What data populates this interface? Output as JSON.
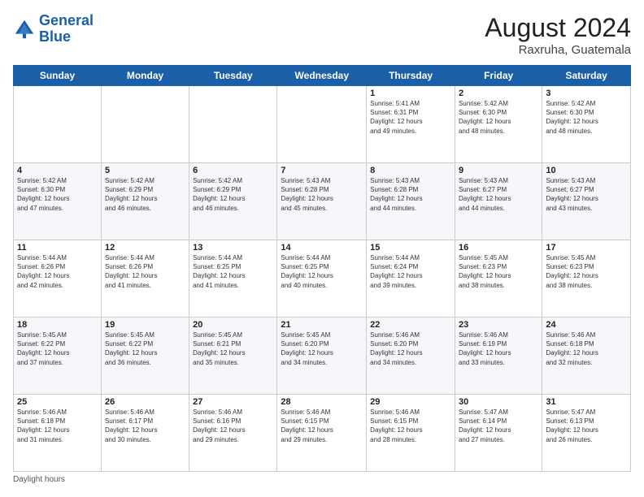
{
  "header": {
    "logo_line1": "General",
    "logo_line2": "Blue",
    "month_year": "August 2024",
    "location": "Raxruha, Guatemala"
  },
  "days_of_week": [
    "Sunday",
    "Monday",
    "Tuesday",
    "Wednesday",
    "Thursday",
    "Friday",
    "Saturday"
  ],
  "weeks": [
    [
      {
        "day": "",
        "info": ""
      },
      {
        "day": "",
        "info": ""
      },
      {
        "day": "",
        "info": ""
      },
      {
        "day": "",
        "info": ""
      },
      {
        "day": "1",
        "info": "Sunrise: 5:41 AM\nSunset: 6:31 PM\nDaylight: 12 hours\nand 49 minutes."
      },
      {
        "day": "2",
        "info": "Sunrise: 5:42 AM\nSunset: 6:30 PM\nDaylight: 12 hours\nand 48 minutes."
      },
      {
        "day": "3",
        "info": "Sunrise: 5:42 AM\nSunset: 6:30 PM\nDaylight: 12 hours\nand 48 minutes."
      }
    ],
    [
      {
        "day": "4",
        "info": "Sunrise: 5:42 AM\nSunset: 6:30 PM\nDaylight: 12 hours\nand 47 minutes."
      },
      {
        "day": "5",
        "info": "Sunrise: 5:42 AM\nSunset: 6:29 PM\nDaylight: 12 hours\nand 46 minutes."
      },
      {
        "day": "6",
        "info": "Sunrise: 5:42 AM\nSunset: 6:29 PM\nDaylight: 12 hours\nand 46 minutes."
      },
      {
        "day": "7",
        "info": "Sunrise: 5:43 AM\nSunset: 6:28 PM\nDaylight: 12 hours\nand 45 minutes."
      },
      {
        "day": "8",
        "info": "Sunrise: 5:43 AM\nSunset: 6:28 PM\nDaylight: 12 hours\nand 44 minutes."
      },
      {
        "day": "9",
        "info": "Sunrise: 5:43 AM\nSunset: 6:27 PM\nDaylight: 12 hours\nand 44 minutes."
      },
      {
        "day": "10",
        "info": "Sunrise: 5:43 AM\nSunset: 6:27 PM\nDaylight: 12 hours\nand 43 minutes."
      }
    ],
    [
      {
        "day": "11",
        "info": "Sunrise: 5:44 AM\nSunset: 6:26 PM\nDaylight: 12 hours\nand 42 minutes."
      },
      {
        "day": "12",
        "info": "Sunrise: 5:44 AM\nSunset: 6:26 PM\nDaylight: 12 hours\nand 41 minutes."
      },
      {
        "day": "13",
        "info": "Sunrise: 5:44 AM\nSunset: 6:25 PM\nDaylight: 12 hours\nand 41 minutes."
      },
      {
        "day": "14",
        "info": "Sunrise: 5:44 AM\nSunset: 6:25 PM\nDaylight: 12 hours\nand 40 minutes."
      },
      {
        "day": "15",
        "info": "Sunrise: 5:44 AM\nSunset: 6:24 PM\nDaylight: 12 hours\nand 39 minutes."
      },
      {
        "day": "16",
        "info": "Sunrise: 5:45 AM\nSunset: 6:23 PM\nDaylight: 12 hours\nand 38 minutes."
      },
      {
        "day": "17",
        "info": "Sunrise: 5:45 AM\nSunset: 6:23 PM\nDaylight: 12 hours\nand 38 minutes."
      }
    ],
    [
      {
        "day": "18",
        "info": "Sunrise: 5:45 AM\nSunset: 6:22 PM\nDaylight: 12 hours\nand 37 minutes."
      },
      {
        "day": "19",
        "info": "Sunrise: 5:45 AM\nSunset: 6:22 PM\nDaylight: 12 hours\nand 36 minutes."
      },
      {
        "day": "20",
        "info": "Sunrise: 5:45 AM\nSunset: 6:21 PM\nDaylight: 12 hours\nand 35 minutes."
      },
      {
        "day": "21",
        "info": "Sunrise: 5:45 AM\nSunset: 6:20 PM\nDaylight: 12 hours\nand 34 minutes."
      },
      {
        "day": "22",
        "info": "Sunrise: 5:46 AM\nSunset: 6:20 PM\nDaylight: 12 hours\nand 34 minutes."
      },
      {
        "day": "23",
        "info": "Sunrise: 5:46 AM\nSunset: 6:19 PM\nDaylight: 12 hours\nand 33 minutes."
      },
      {
        "day": "24",
        "info": "Sunrise: 5:46 AM\nSunset: 6:18 PM\nDaylight: 12 hours\nand 32 minutes."
      }
    ],
    [
      {
        "day": "25",
        "info": "Sunrise: 5:46 AM\nSunset: 6:18 PM\nDaylight: 12 hours\nand 31 minutes."
      },
      {
        "day": "26",
        "info": "Sunrise: 5:46 AM\nSunset: 6:17 PM\nDaylight: 12 hours\nand 30 minutes."
      },
      {
        "day": "27",
        "info": "Sunrise: 5:46 AM\nSunset: 6:16 PM\nDaylight: 12 hours\nand 29 minutes."
      },
      {
        "day": "28",
        "info": "Sunrise: 5:46 AM\nSunset: 6:15 PM\nDaylight: 12 hours\nand 29 minutes."
      },
      {
        "day": "29",
        "info": "Sunrise: 5:46 AM\nSunset: 6:15 PM\nDaylight: 12 hours\nand 28 minutes."
      },
      {
        "day": "30",
        "info": "Sunrise: 5:47 AM\nSunset: 6:14 PM\nDaylight: 12 hours\nand 27 minutes."
      },
      {
        "day": "31",
        "info": "Sunrise: 5:47 AM\nSunset: 6:13 PM\nDaylight: 12 hours\nand 26 minutes."
      }
    ]
  ],
  "footer": {
    "note": "Daylight hours"
  }
}
